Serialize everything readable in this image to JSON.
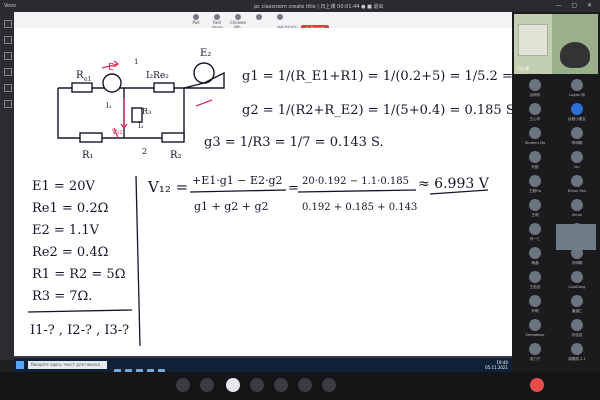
{
  "app": {
    "name": "Voov",
    "title": "pc classroom create title | 日上课 00:01:44  ● ■ 退出"
  },
  "toolbar": {
    "items": [
      "Pull",
      "Fast share",
      "Chinese Wh.",
      "",
      "",
      "",
      ""
    ],
    "pill": "00:33:33",
    "record": "● Record",
    "chat": "✎ 开始聊天"
  },
  "whiteboard": {
    "equations": {
      "g1": "g1 = 1/(R_E1+R1) = 1/(0.2+5) = 1/5.2 = 0.192 S.",
      "g2": "g2 = 1/(R2+R_E2) = 1/(5+0.4) = 0.185 S,",
      "g3": "g3 = 1/R3 = 1/7 = 0.143 S.",
      "v12_num": "+E1·g1 − E2·g2",
      "v12_den": "g1 + g2 + g2",
      "v12_num2": "20·0.192 − 1.1·0.185",
      "v12_den2": "0.192 + 0.185 + 0.143",
      "result": "≈ 6.993 V"
    },
    "givens": [
      "E1 = 20V",
      "Re1 = 0.2Ω",
      "E2 = 1.1V",
      "Re2 = 0.4Ω",
      "R1 = R2 = 5Ω",
      "R3 = 7Ω."
    ],
    "question": "I1-? , I2-? , I3-?"
  },
  "taskbar": {
    "search_placeholder": "Введите здесь текст для поиска",
    "time": "19:40",
    "date": "05.11.2021"
  },
  "participants": {
    "camera_name": "日上课",
    "list": [
      "谷明宇",
      "Logan 用",
      "王心宇",
      "后程小朋友",
      "Student Mo",
      "李明明",
      "刘韵",
      "Ian",
      "王韵Ra",
      "Ethan Ren",
      "王明",
      "Imran",
      "刘一仁",
      "WangZ",
      "蒋晶",
      "刘明明",
      "王若含",
      "LiaoGang",
      "刘明",
      "潘涵仁",
      "Zimbabwe",
      "刘佳佳",
      "汤力宁",
      "胡丽丽 2.1"
    ]
  }
}
